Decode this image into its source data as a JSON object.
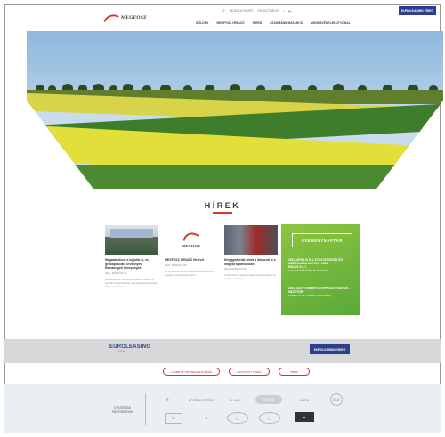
{
  "topbar": {
    "search_icon": "search-icon",
    "link1": "BEJELENTKEZÉS",
    "link2": "REGISZTRÁCIÓ",
    "cta": "EUROLEASING VÍDEÓ"
  },
  "brand": {
    "name": "MEGFOSZ",
    "accent": "#d73a2c",
    "navy": "#2c3e8c"
  },
  "nav": [
    "KÖLÜNK",
    "MEGFOSZ HÍRADÓ",
    "HÍREK",
    "SZAKMÁNK MATANCS",
    "MUNKAVÉDELMI ÚTVONAL"
  ],
  "news": {
    "heading": "HÍREK",
    "items": [
      {
        "title": "Megalakultunk a legjobb 3L és gépkapcsolat! Örvösnyés Rajnaszigeti ünnepségek",
        "date": "2022. MÁRCIUS 11.",
        "text": "Gépkezelő és műszaki kezelőként kellően, a legjobb is kapcsolódva, a legjobb szakemberek kellő elismerésben."
      },
      {
        "title": "MEGFOSZ HÍRADÓ Hírlevél",
        "date": "2022. MÁRCIUS 09.",
        "text": "Az új hírlevél szerint a gépkezelőkkel lehet a legjobb eredményeket elérni."
      },
      {
        "title": "Még gyakoriak lettek a faluszoti is a magyar agráriumban",
        "date": "2022. MÁRCIUS 02.",
        "text": "Gépkezelés, foglalkoztatás, munkavédelem és technika alapjai is."
      }
    ]
  },
  "events": {
    "heading": "ESEMÉNYNAPTÁR",
    "items": [
      {
        "title": "2022. ÁPRILIS ELLÁTÁSTERVEZÉS ÉS MEZŐGAZDA NAPOK - 2022.",
        "date": "MÁJUS 5-6-7.",
        "place": "AGRÁRVÁSÁRTÉR, BUDAPEST"
      },
      {
        "title": "2022. SZEPTEMBER 8. GÉPÉSZETI NAPOK - MEZŐTÚR",
        "date": "",
        "place": "KÖZÉP-ÚTON VÁSÁR, BUDAPEST"
      }
    ]
  },
  "band": {
    "logo": "EUROLEASING",
    "logo_sub": "Lízing",
    "button": "EUROLEASING VÍDEÓ"
  },
  "pills": [
    "ÚJABB 16 HÍR MEGTEKINTÉSE",
    "ARCHIVÁLT HÍREK",
    "HÍREK"
  ],
  "partners": {
    "label_line1": "STRATÉGIAI",
    "label_line2": "PARTNEREINK",
    "logos": [
      "KÖZÉPKUTATÁS",
      "CLAAS",
      "DEERE",
      "MADE",
      "DLG"
    ]
  }
}
